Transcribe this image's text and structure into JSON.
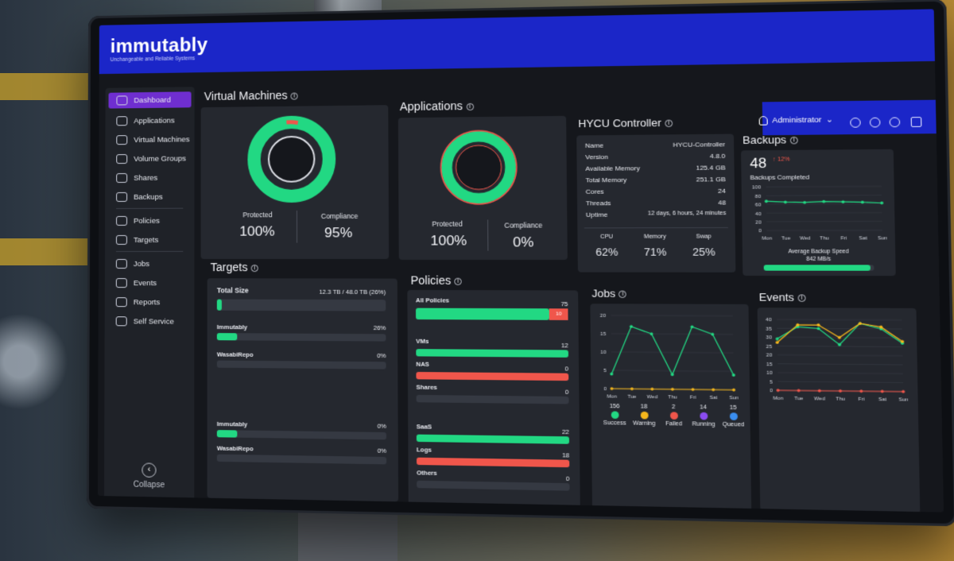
{
  "brand": {
    "name": "immutably",
    "tagline": "Unchangeable and Reliable Systems"
  },
  "header": {
    "user": "Administrator"
  },
  "sidebar": {
    "items": [
      {
        "label": "Dashboard",
        "icon": "home-icon",
        "active": true
      },
      {
        "label": "Applications",
        "icon": "apps-icon"
      },
      {
        "label": "Virtual Machines",
        "icon": "vm-icon"
      },
      {
        "label": "Volume Groups",
        "icon": "volume-icon"
      },
      {
        "label": "Shares",
        "icon": "share-icon"
      },
      {
        "label": "Backups",
        "icon": "backup-icon"
      },
      {
        "label": "Policies",
        "icon": "policy-icon"
      },
      {
        "label": "Targets",
        "icon": "target-icon"
      },
      {
        "label": "Jobs",
        "icon": "jobs-icon"
      },
      {
        "label": "Events",
        "icon": "events-icon"
      },
      {
        "label": "Reports",
        "icon": "reports-icon"
      },
      {
        "label": "Self Service",
        "icon": "self-service-icon"
      }
    ],
    "collapse": "Collapse"
  },
  "vms": {
    "title": "Virtual Machines",
    "protected_label": "Protected",
    "protected": "100%",
    "compliance_label": "Compliance",
    "compliance": "95%"
  },
  "apps": {
    "title": "Applications",
    "protected_label": "Protected",
    "protected": "100%",
    "compliance_label": "Compliance",
    "compliance": "0%"
  },
  "hycu": {
    "title": "HYCU Controller",
    "rows": [
      {
        "k": "Name",
        "v": "HYCU-Controller"
      },
      {
        "k": "Version",
        "v": "4.8.0"
      },
      {
        "k": "Available Memory",
        "v": "125.4 GB"
      },
      {
        "k": "Total Memory",
        "v": "251.1 GB"
      },
      {
        "k": "Cores",
        "v": "24"
      },
      {
        "k": "Threads",
        "v": "48"
      },
      {
        "k": "Uptime",
        "v": "12 days, 6 hours, 24 minutes"
      }
    ],
    "stats": [
      {
        "k": "CPU",
        "v": "62%"
      },
      {
        "k": "Memory",
        "v": "71%"
      },
      {
        "k": "Swap",
        "v": "25%"
      }
    ]
  },
  "backups": {
    "title": "Backups",
    "count": "48",
    "change": "↑ 12%",
    "completed_label": "Backups Completed",
    "speed_label": "Average Backup Speed",
    "speed": "842 MB/s",
    "speed_fill": 0.97
  },
  "targets": {
    "title": "Targets",
    "total_label": "Total Size",
    "total_value": "12.3 TB / 48.0 TB (26%)",
    "total_fill": 0.03,
    "rows": [
      {
        "name": "Immutably",
        "value": "26%",
        "fill": 0.12
      },
      {
        "name": "WasabiRepo",
        "value": "0%",
        "fill": 0
      },
      {
        "name": "Immutably",
        "value": "0%",
        "fill": 0.12
      },
      {
        "name": "WasabiRepo",
        "value": "0%",
        "fill": 0
      }
    ]
  },
  "policies": {
    "title": "Policies",
    "rows": [
      {
        "name": "All Policies",
        "value": "75",
        "extra": "10",
        "fill": 0.88,
        "color": "#22d883"
      },
      {
        "name": "VMs",
        "value": "12",
        "fill": 1,
        "color": "#22d883"
      },
      {
        "name": "NAS",
        "value": "0",
        "fill": 1,
        "color": "#f0564b"
      },
      {
        "name": "Shares",
        "value": "0",
        "fill": 0,
        "color": "#22d883"
      },
      {
        "name": "SaaS",
        "value": "22",
        "fill": 1,
        "color": "#22d883"
      },
      {
        "name": "Logs",
        "value": "18",
        "fill": 1,
        "color": "#f0564b"
      },
      {
        "name": "Others",
        "value": "0",
        "fill": 0,
        "color": "#22d883"
      }
    ]
  },
  "jobs": {
    "title": "Jobs",
    "legend": [
      {
        "label": "Success",
        "count": "156",
        "color": "#22d883"
      },
      {
        "label": "Warning",
        "count": "18",
        "color": "#f5b71c"
      },
      {
        "label": "Failed",
        "count": "2",
        "color": "#f0564b"
      },
      {
        "label": "Running",
        "count": "14",
        "color": "#8a4cf0"
      },
      {
        "label": "Queued",
        "count": "15",
        "color": "#3a8ef0"
      }
    ]
  },
  "events": {
    "title": "Events"
  },
  "chart_data": [
    {
      "type": "line",
      "title": "Backups Completed",
      "x": [
        "Mon",
        "Tue",
        "Wed",
        "Thu",
        "Fri",
        "Sat",
        "Sun"
      ],
      "yticks": [
        100,
        80,
        60,
        40,
        20,
        0
      ],
      "ylim": [
        0,
        100
      ],
      "series": [
        {
          "values": [
            67,
            65,
            64,
            66,
            65,
            64,
            62
          ],
          "color": "#22d883"
        }
      ]
    },
    {
      "type": "line",
      "title": "Jobs",
      "x": [
        "Mon",
        "Tue",
        "Wed",
        "Thu",
        "Fri",
        "Sat",
        "Sun"
      ],
      "yticks": [
        20,
        15,
        10,
        5,
        0
      ],
      "ylim": [
        0,
        20
      ],
      "series": [
        {
          "values": [
            4,
            17,
            15,
            4,
            17,
            15,
            4
          ],
          "color": "#22d883"
        },
        {
          "values": [
            0,
            0,
            0,
            0,
            0,
            0,
            0
          ],
          "color": "#f5b71c"
        }
      ]
    },
    {
      "type": "line",
      "title": "Events",
      "x": [
        "Mon",
        "Tue",
        "Wed",
        "Thu",
        "Fri",
        "Sat",
        "Sun"
      ],
      "yticks": [
        40,
        35,
        30,
        25,
        20,
        15,
        10,
        5,
        0
      ],
      "ylim": [
        0,
        40
      ],
      "series": [
        {
          "values": [
            29,
            36,
            35,
            26,
            38,
            35,
            27
          ],
          "color": "#22d883"
        },
        {
          "values": [
            27,
            37,
            37,
            30,
            38,
            36,
            28
          ],
          "color": "#f5b71c"
        },
        {
          "values": [
            0,
            0,
            0,
            0,
            0,
            0,
            0
          ],
          "color": "#f0564b"
        }
      ]
    }
  ]
}
